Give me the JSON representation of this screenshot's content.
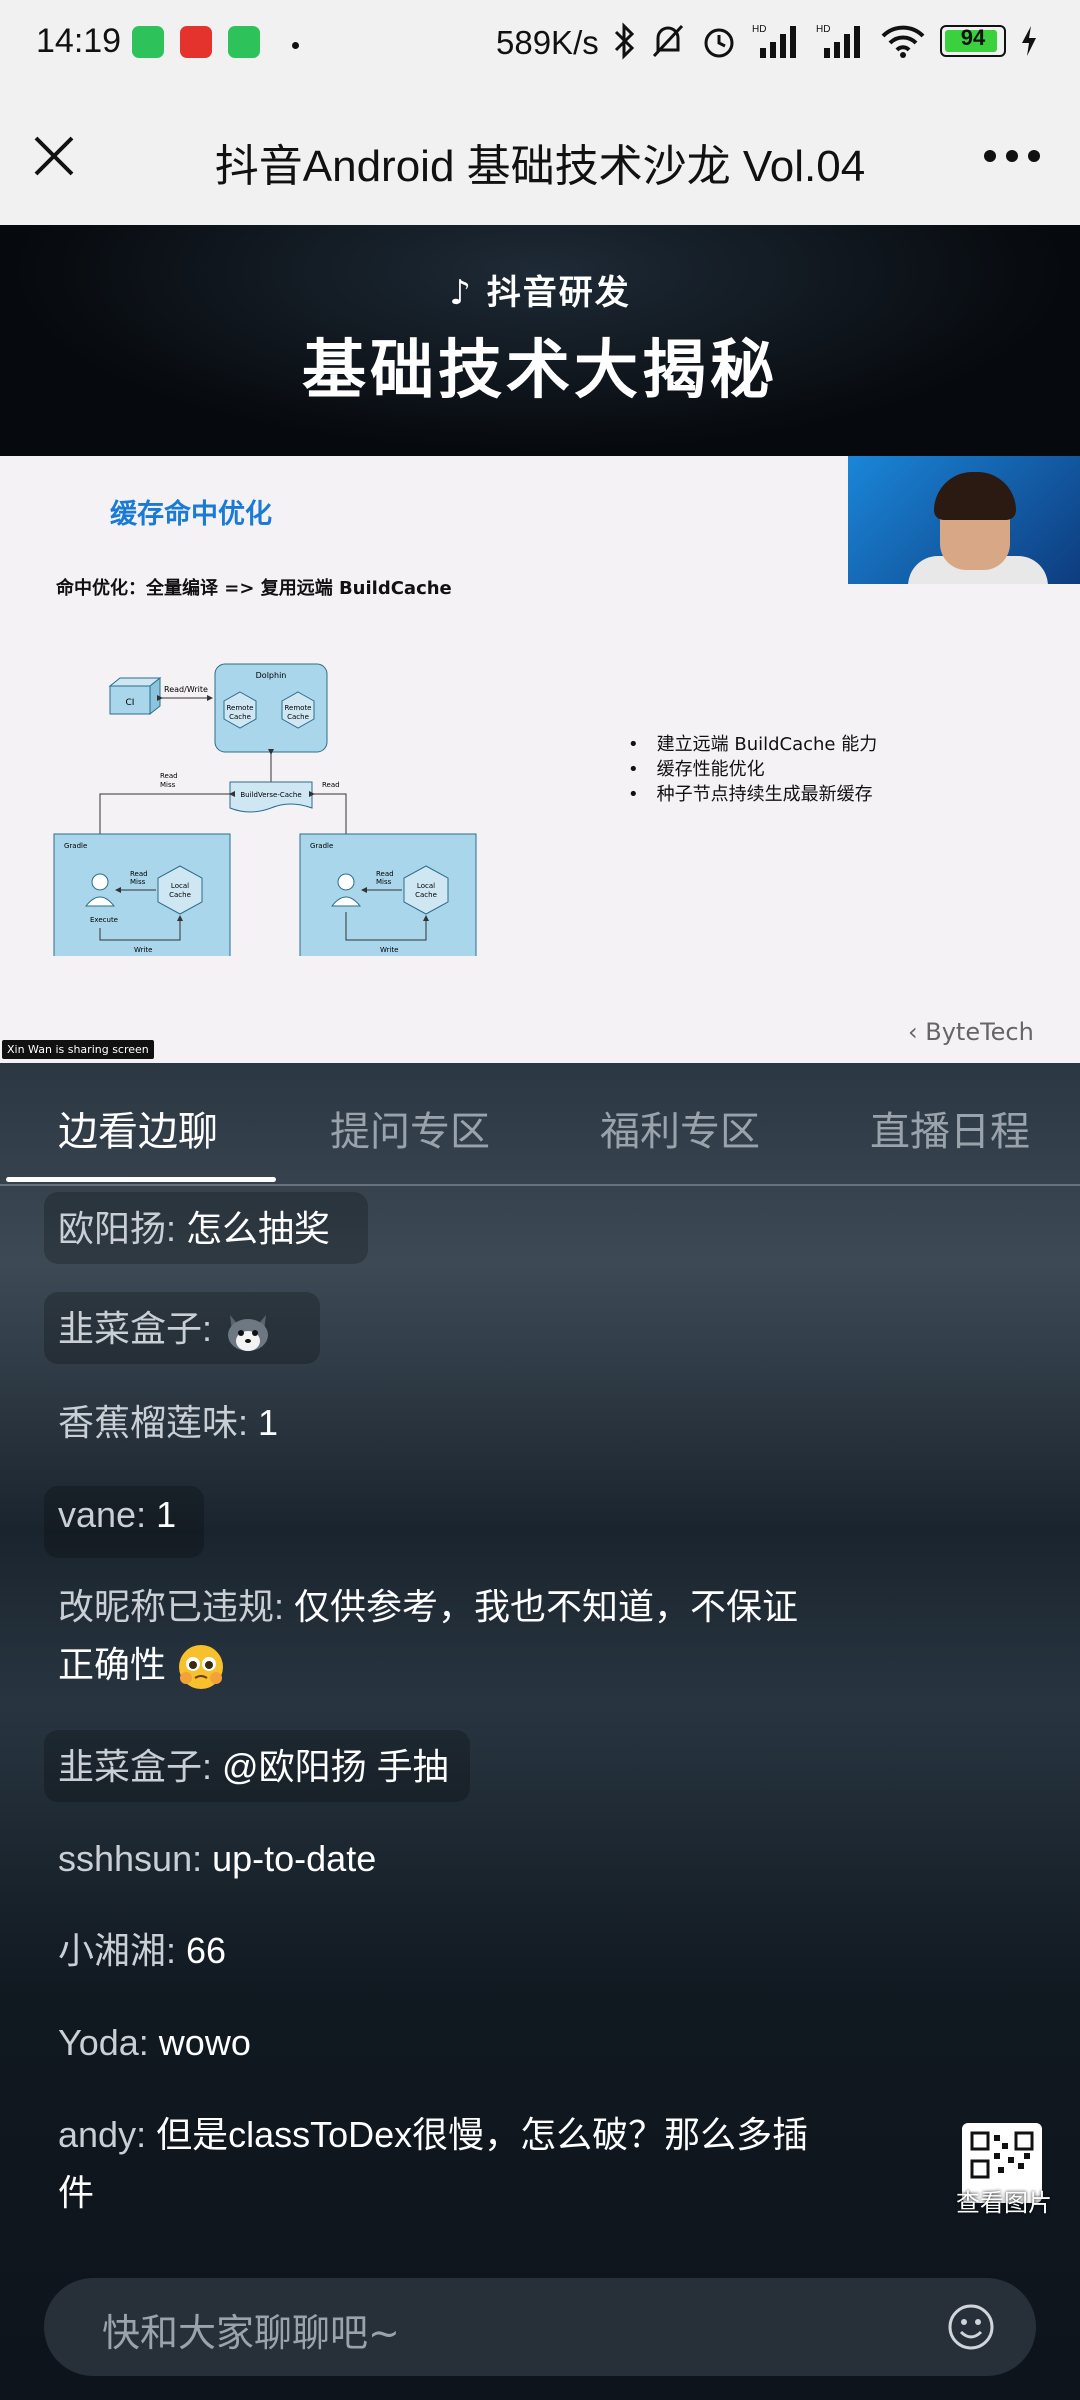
{
  "status_bar": {
    "time": "14:19",
    "network_speed": "589K/s",
    "battery": "94",
    "icons": [
      "wechat-app-icon",
      "mail-app-icon",
      "phone-app-icon",
      "bluetooth-icon",
      "mute-icon",
      "alarm-icon",
      "signal-hd-icon",
      "signal-hd-icon",
      "wifi-icon",
      "charging-icon"
    ]
  },
  "nav": {
    "title": "抖音Android 基础技术沙龙 Vol.04"
  },
  "banner": {
    "subtitle": "抖音研发",
    "title": "基础技术大揭秘"
  },
  "slide": {
    "title": "缓存命中优化",
    "subtitle": "命中优化：全量编译 => 复用远端 BuildCache",
    "bullets": [
      "建立远端 BuildCache 能力",
      "缓存性能优化",
      "种子节点持续生成最新缓存"
    ],
    "diagram": {
      "ci": "CI",
      "read_write": "Read/Write",
      "dolphin": "Dolphin",
      "remote_cache": "Remote Cache",
      "buildverse": "BuildVerse-Cache",
      "read_miss": "Read Miss",
      "read": "Read",
      "gradle": "Gradle",
      "execute": "Execute",
      "local_cache": "Local Cache",
      "write": "Write"
    },
    "brand": "ByteTech",
    "sharing_notice": "Xin Wan is sharing screen"
  },
  "tabs": [
    {
      "label": "边看边聊",
      "active": true
    },
    {
      "label": "提问专区",
      "active": false
    },
    {
      "label": "福利专区",
      "active": false
    },
    {
      "label": "直播日程",
      "active": false
    }
  ],
  "messages": [
    {
      "user": "欧阳扬:",
      "text": "怎么抽奖"
    },
    {
      "user": "韭菜盒子:",
      "text": "",
      "emoji": "husky-emoji"
    },
    {
      "user": "香蕉榴莲味:",
      "text": "1"
    },
    {
      "user": "vane:",
      "text": "1"
    },
    {
      "user": "改昵称已违规:",
      "text": "仅供参考，我也不知道，不保证",
      "text2": "正确性",
      "emoji": "pleading-emoji"
    },
    {
      "user": "韭菜盒子:",
      "text": "@欧阳扬 手抽"
    },
    {
      "user": "sshhsun:",
      "text": "up-to-date"
    },
    {
      "user": "小湘湘:",
      "text": "66"
    },
    {
      "user": "Yoda:",
      "text": "wowo"
    },
    {
      "user": "andy:",
      "text": "但是classToDex很慢，怎么破？那么多插",
      "text2": "件"
    }
  ],
  "qr_button": {
    "label": "查看图片"
  },
  "input": {
    "placeholder": "快和大家聊聊吧~"
  },
  "colors": {
    "accent_blue": "#1a7bd6",
    "battery_green": "#3bd13e"
  }
}
